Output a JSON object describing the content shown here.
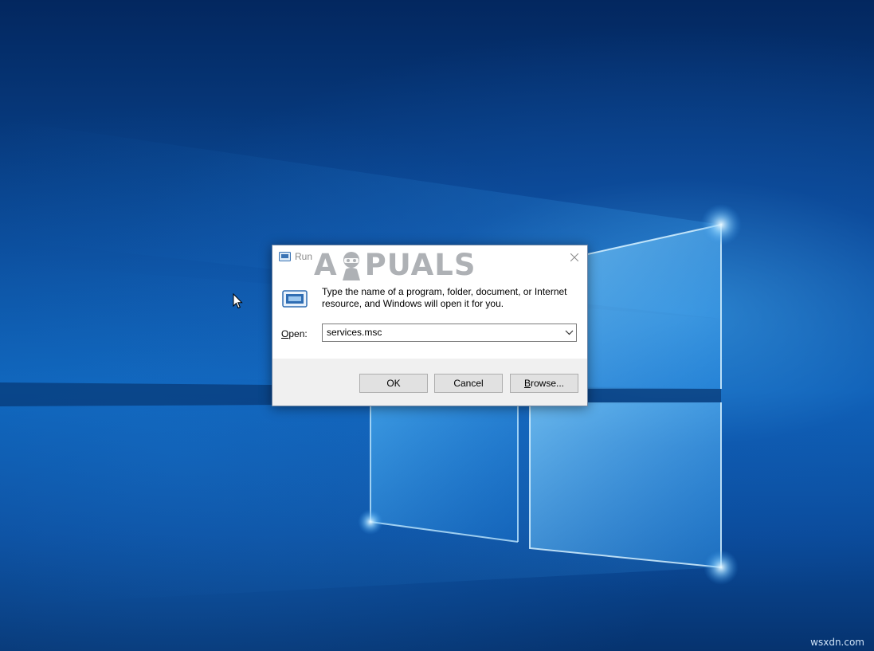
{
  "dialog": {
    "title": "Run",
    "watermark_text_left": "A",
    "watermark_text_right": "PUALS",
    "description": "Type the name of a program, folder, document, or Internet resource, and Windows will open it for you.",
    "open_label_accel": "O",
    "open_label_rest": "pen:",
    "open_value": "services.msc",
    "buttons": {
      "ok": "OK",
      "cancel": "Cancel",
      "browse_accel": "B",
      "browse_rest": "rowse..."
    }
  },
  "site_watermark": "wsxdn.com",
  "icons": {
    "title": "run-icon",
    "close": "close-icon",
    "dropdown": "chevron-down-icon",
    "cursor": "mouse-pointer-icon"
  },
  "colors": {
    "wallpaper_dark": "#03275f",
    "wallpaper_light": "#3a9ae6",
    "dialog_border": "#6e86a6",
    "footer_bg": "#f0f0f0",
    "button_bg": "#e1e1e1"
  }
}
